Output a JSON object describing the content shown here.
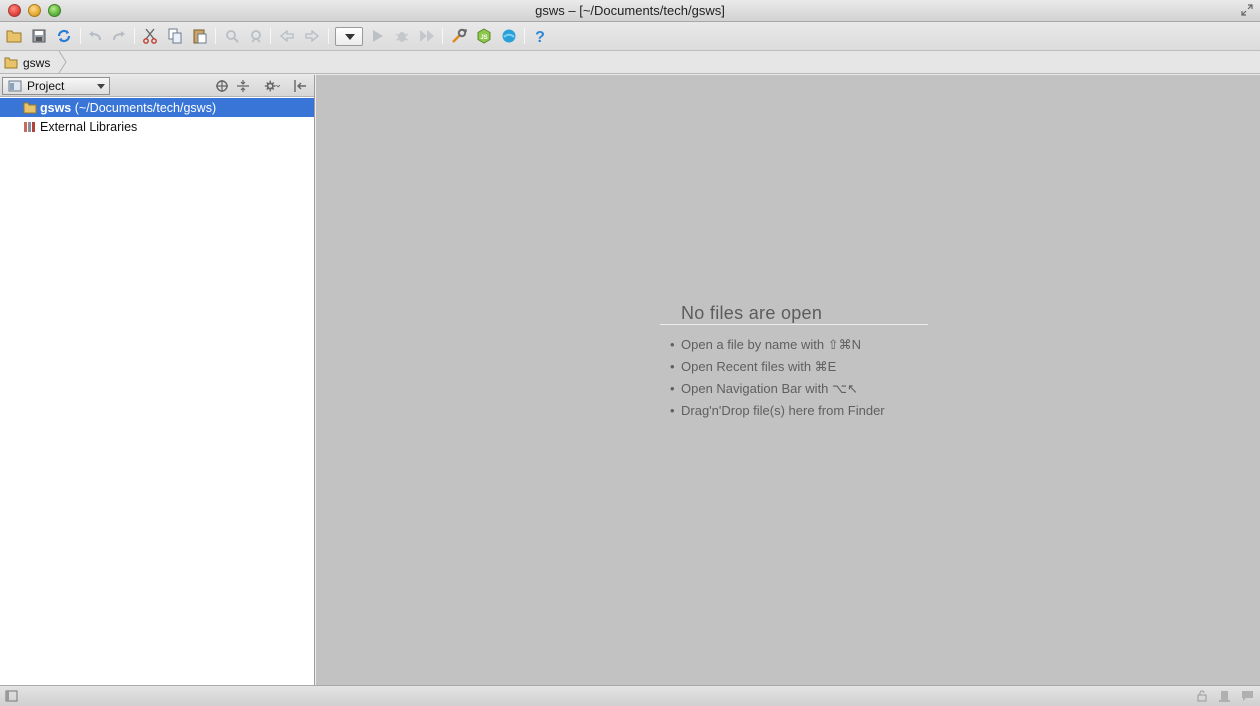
{
  "window": {
    "title": "gsws – [~/Documents/tech/gsws]"
  },
  "toolbar": {
    "icons": [
      "open-folder-icon",
      "save-icon",
      "sync-icon",
      "undo-icon",
      "redo-icon",
      "cut-icon",
      "copy-icon",
      "paste-icon",
      "find-icon",
      "replace-icon",
      "back-icon",
      "forward-icon",
      "run-config-dropdown",
      "run-icon",
      "debug-icon",
      "coverage-icon",
      "settings-wrench-icon",
      "nodejs-icon",
      "webstorm-icon",
      "help-icon"
    ]
  },
  "navbar": {
    "crumb": "gsws"
  },
  "project_panel": {
    "view_label": "Project",
    "tree": [
      {
        "name_bold": "gsws",
        "name_rest": " (~/Documents/tech/gsws)",
        "selected": true
      },
      {
        "name_bold": "",
        "name_rest": "External Libraries",
        "selected": false
      }
    ]
  },
  "editor": {
    "empty_title": "No files are open",
    "hints": [
      "Open a file by name with ⇧⌘N",
      "Open Recent files with ⌘E",
      "Open Navigation Bar with ⌥↖",
      "Drag'n'Drop file(s) here from Finder"
    ]
  },
  "colors": {
    "selection": "#3875d7",
    "editor_bg": "#c2c2c2",
    "panel_bg": "#ffffff"
  }
}
